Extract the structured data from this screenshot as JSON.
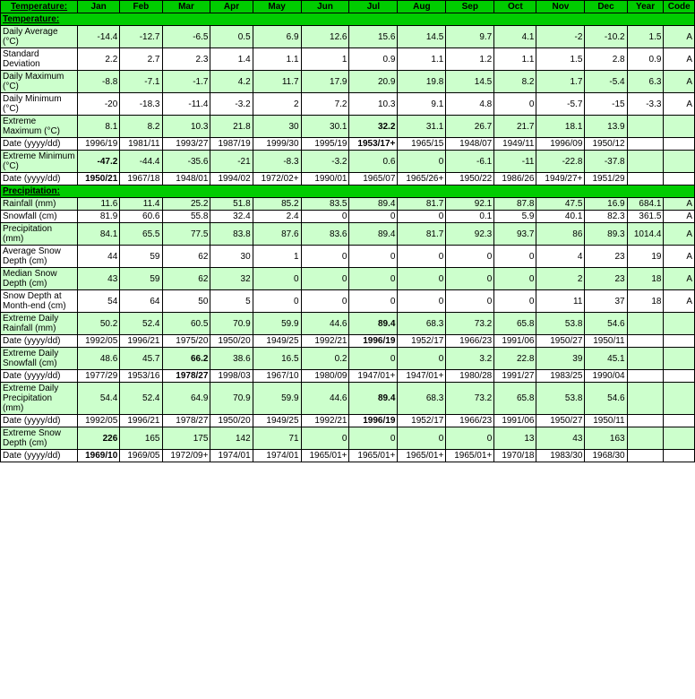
{
  "headers": [
    "",
    "Jan",
    "Feb",
    "Mar",
    "Apr",
    "May",
    "Jun",
    "Jul",
    "Aug",
    "Sep",
    "Oct",
    "Nov",
    "Dec",
    "Year",
    "Code"
  ],
  "sections": [
    {
      "type": "section-header",
      "label": "Temperature:"
    },
    {
      "type": "data-row",
      "class": "row-green",
      "label": "Daily Average (°C)",
      "values": [
        "-14.4",
        "-12.7",
        "-6.5",
        "0.5",
        "6.9",
        "12.6",
        "15.6",
        "14.5",
        "9.7",
        "4.1",
        "-2",
        "-10.2",
        "1.5",
        "A"
      ]
    },
    {
      "type": "data-row",
      "class": "row-white",
      "label": "Standard Deviation",
      "values": [
        "2.2",
        "2.7",
        "2.3",
        "1.4",
        "1.1",
        "1",
        "0.9",
        "1.1",
        "1.2",
        "1.1",
        "1.5",
        "2.8",
        "0.9",
        "A"
      ]
    },
    {
      "type": "data-row",
      "class": "row-green",
      "label": "Daily Maximum (°C)",
      "values": [
        "-8.8",
        "-7.1",
        "-1.7",
        "4.2",
        "11.7",
        "17.9",
        "20.9",
        "19.8",
        "14.5",
        "8.2",
        "1.7",
        "-5.4",
        "6.3",
        "A"
      ]
    },
    {
      "type": "data-row",
      "class": "row-white",
      "label": "Daily Minimum (°C)",
      "values": [
        "-20",
        "-18.3",
        "-11.4",
        "-3.2",
        "2",
        "7.2",
        "10.3",
        "9.1",
        "4.8",
        "0",
        "-5.7",
        "-15",
        "-3.3",
        "A"
      ]
    },
    {
      "type": "data-row",
      "class": "row-green",
      "label": "Extreme Maximum (°C)",
      "values": [
        "8.1",
        "8.2",
        "10.3",
        "21.8",
        "30",
        "30.1",
        "32.2",
        "31.1",
        "26.7",
        "21.7",
        "18.1",
        "13.9",
        "",
        ""
      ],
      "bold": [
        6
      ]
    },
    {
      "type": "data-row",
      "class": "row-white",
      "label": "Date (yyyy/dd)",
      "values": [
        "1996/19",
        "1981/11",
        "1993/27",
        "1987/19",
        "1999/30",
        "1995/19",
        "1953/17+",
        "1965/15",
        "1948/07",
        "1949/11",
        "1996/09",
        "1950/12",
        "",
        ""
      ],
      "bold": [
        6
      ]
    },
    {
      "type": "data-row",
      "class": "row-green",
      "label": "Extreme Minimum (°C)",
      "values": [
        "-47.2",
        "-44.4",
        "-35.6",
        "-21",
        "-8.3",
        "-3.2",
        "0.6",
        "0",
        "-6.1",
        "-11",
        "-22.8",
        "-37.8",
        "",
        ""
      ],
      "bold": [
        0
      ]
    },
    {
      "type": "data-row",
      "class": "row-white",
      "label": "Date (yyyy/dd)",
      "values": [
        "1950/21",
        "1967/18",
        "1948/01",
        "1994/02",
        "1972/02+",
        "1990/01",
        "1965/07",
        "1965/26+",
        "1950/22",
        "1986/26",
        "1949/27+",
        "1951/29",
        "",
        ""
      ],
      "bold": [
        0
      ]
    },
    {
      "type": "section-header",
      "label": "Precipitation:"
    },
    {
      "type": "data-row",
      "class": "row-green",
      "label": "Rainfall (mm)",
      "values": [
        "11.6",
        "11.4",
        "25.2",
        "51.8",
        "85.2",
        "83.5",
        "89.4",
        "81.7",
        "92.1",
        "87.8",
        "47.5",
        "16.9",
        "684.1",
        "A"
      ]
    },
    {
      "type": "data-row",
      "class": "row-white",
      "label": "Snowfall (cm)",
      "values": [
        "81.9",
        "60.6",
        "55.8",
        "32.4",
        "2.4",
        "0",
        "0",
        "0",
        "0.1",
        "5.9",
        "40.1",
        "82.3",
        "361.5",
        "A"
      ]
    },
    {
      "type": "data-row",
      "class": "row-green",
      "label": "Precipitation (mm)",
      "values": [
        "84.1",
        "65.5",
        "77.5",
        "83.8",
        "87.6",
        "83.6",
        "89.4",
        "81.7",
        "92.3",
        "93.7",
        "86",
        "89.3",
        "1014.4",
        "A"
      ]
    },
    {
      "type": "data-row",
      "class": "row-white",
      "label": "Average Snow Depth (cm)",
      "values": [
        "44",
        "59",
        "62",
        "30",
        "1",
        "0",
        "0",
        "0",
        "0",
        "0",
        "4",
        "23",
        "19",
        "A"
      ]
    },
    {
      "type": "data-row",
      "class": "row-green",
      "label": "Median Snow Depth (cm)",
      "values": [
        "43",
        "59",
        "62",
        "32",
        "0",
        "0",
        "0",
        "0",
        "0",
        "0",
        "2",
        "23",
        "18",
        "A"
      ]
    },
    {
      "type": "data-row",
      "class": "row-white",
      "label": "Snow Depth at Month-end (cm)",
      "values": [
        "54",
        "64",
        "50",
        "5",
        "0",
        "0",
        "0",
        "0",
        "0",
        "0",
        "11",
        "37",
        "18",
        "A"
      ]
    },
    {
      "type": "data-row",
      "class": "row-green",
      "label": "Extreme Daily Rainfall (mm)",
      "values": [
        "50.2",
        "52.4",
        "60.5",
        "70.9",
        "59.9",
        "44.6",
        "89.4",
        "68.3",
        "73.2",
        "65.8",
        "53.8",
        "54.6",
        "",
        ""
      ],
      "bold": [
        6
      ]
    },
    {
      "type": "data-row",
      "class": "row-white",
      "label": "Date (yyyy/dd)",
      "values": [
        "1992/05",
        "1996/21",
        "1975/20",
        "1950/20",
        "1949/25",
        "1992/21",
        "1996/19",
        "1952/17",
        "1966/23",
        "1991/06",
        "1950/27",
        "1950/11",
        "",
        ""
      ],
      "bold": [
        6
      ]
    },
    {
      "type": "data-row",
      "class": "row-green",
      "label": "Extreme Daily Snowfall (cm)",
      "values": [
        "48.6",
        "45.7",
        "66.2",
        "38.6",
        "16.5",
        "0.2",
        "0",
        "0",
        "3.2",
        "22.8",
        "39",
        "45.1",
        "",
        ""
      ],
      "bold": [
        2
      ]
    },
    {
      "type": "data-row",
      "class": "row-white",
      "label": "Date (yyyy/dd)",
      "values": [
        "1977/29",
        "1953/16",
        "1978/27",
        "1998/03",
        "1967/10",
        "1980/09",
        "1947/01+",
        "1947/01+",
        "1980/28",
        "1991/27",
        "1983/25",
        "1990/04",
        "",
        ""
      ],
      "bold": [
        2
      ]
    },
    {
      "type": "data-row",
      "class": "row-green",
      "label": "Extreme Daily Precipitation (mm)",
      "values": [
        "54.4",
        "52.4",
        "64.9",
        "70.9",
        "59.9",
        "44.6",
        "89.4",
        "68.3",
        "73.2",
        "65.8",
        "53.8",
        "54.6",
        "",
        ""
      ],
      "bold": [
        6
      ]
    },
    {
      "type": "data-row",
      "class": "row-white",
      "label": "Date (yyyy/dd)",
      "values": [
        "1992/05",
        "1996/21",
        "1978/27",
        "1950/20",
        "1949/25",
        "1992/21",
        "1996/19",
        "1952/17",
        "1966/23",
        "1991/06",
        "1950/27",
        "1950/11",
        "",
        ""
      ],
      "bold": [
        6
      ]
    },
    {
      "type": "data-row",
      "class": "row-green",
      "label": "Extreme Snow Depth (cm)",
      "values": [
        "226",
        "165",
        "175",
        "142",
        "71",
        "0",
        "0",
        "0",
        "0",
        "13",
        "43",
        "163",
        "",
        ""
      ],
      "bold": [
        0
      ]
    },
    {
      "type": "data-row",
      "class": "row-white",
      "label": "Date (yyyy/dd)",
      "values": [
        "1969/10",
        "1969/05",
        "1972/09+",
        "1974/01",
        "1974/01",
        "1965/01+",
        "1965/01+",
        "1965/01+",
        "1965/01+",
        "1970/18",
        "1983/30",
        "1968/30",
        "",
        ""
      ],
      "bold": [
        0
      ]
    }
  ]
}
